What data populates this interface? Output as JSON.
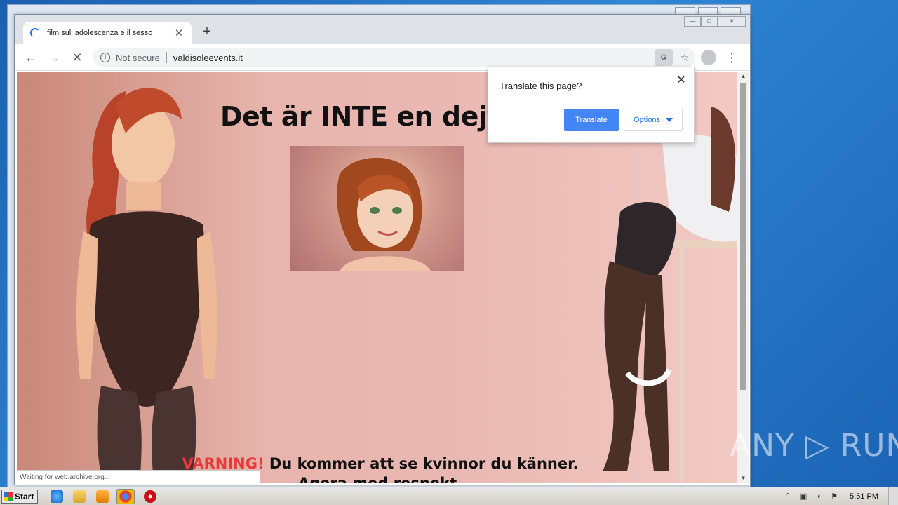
{
  "tab": {
    "title": "film sull adolescenza e il sesso",
    "close": "✕",
    "new_tab": "+"
  },
  "window_controls": {
    "minimize": "—",
    "maximize": "□",
    "close": "✕"
  },
  "toolbar": {
    "back": "←",
    "forward": "→",
    "stop": "✕",
    "security_label": "Not secure",
    "url": "valdisoleevents.it",
    "translate_icon": "G",
    "bookmark": "☆",
    "menu": "⋮"
  },
  "page": {
    "headline": "Det är INTE en dejtingsajt!",
    "warning_red": "VARNING!",
    "warning_text": " Du kommer att se kvinnor du känner. Agera med respekt.",
    "status": "Waiting for web.archive.org..."
  },
  "translate_bubble": {
    "title": "Translate this page?",
    "close": "✕",
    "translate_button": "Translate",
    "options_button": "Options"
  },
  "watermark": "ANY ▷ RUN",
  "taskbar": {
    "start": "Start",
    "clock": "5:51 PM"
  },
  "colors": {
    "accent": "#4285f4",
    "warning_red": "#e83a3a",
    "page_background": "#e7b5ad"
  }
}
